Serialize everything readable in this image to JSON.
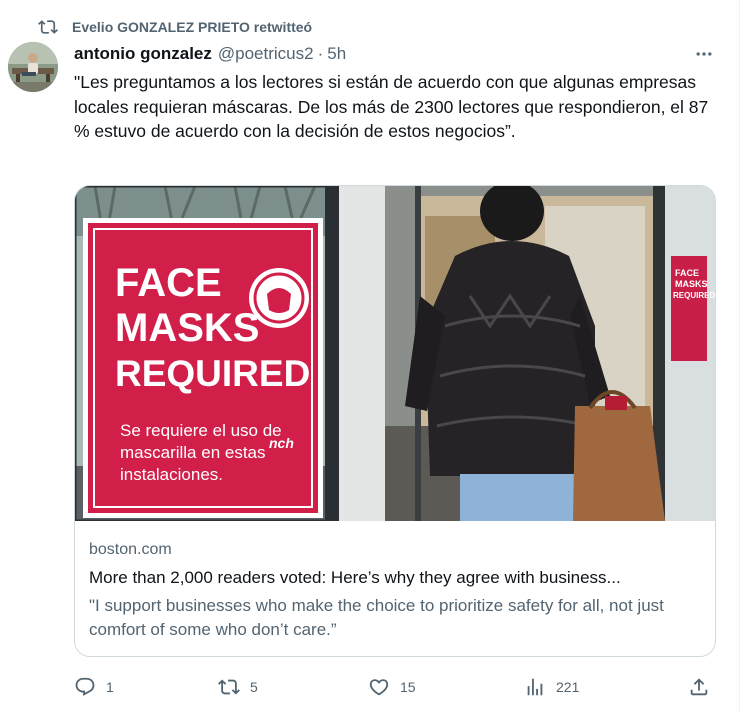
{
  "retweet_banner": {
    "icon": "retweet-icon",
    "text": "Evelio GONZALEZ PRIETO retwitteó"
  },
  "tweet": {
    "author_name": "antonio gonzalez",
    "author_handle": "@poetricus2",
    "separator": "·",
    "time": "5h",
    "text": "\"Les preguntamos a los lectores si están de acuerdo con que algunas empresas locales requieran máscaras. De los más de 2300 lectores que respondieron, el 87 % estuvo de acuerdo con la decisión de estos negocios”."
  },
  "card": {
    "image": {
      "sign_lines": [
        "FACE",
        "MASKS",
        "REQUIRED"
      ],
      "sign_subtext": [
        "Se requiere el uso de",
        "mascarilla en estas",
        "instalaciones."
      ],
      "sign_logo": "nch",
      "small_sign_lines": [
        "FACE",
        "MASKS",
        "REQUIRED"
      ],
      "colors": {
        "sign": "#d21f4a",
        "sign_border": "#ffffff",
        "jacket": "#1f1d1f",
        "jeans": "#8fb2d8",
        "bag": "#a0683f"
      }
    },
    "domain": "boston.com",
    "title": "More than 2,000 readers voted: Here’s why they agree with business...",
    "description": "\"I support businesses who make the choice to prioritize safety for all, not just comfort of some who don’t care.”"
  },
  "actions": {
    "reply": {
      "icon": "reply-icon",
      "count": "1"
    },
    "retweet": {
      "icon": "retweet-icon",
      "count": "5"
    },
    "like": {
      "icon": "heart-icon",
      "count": "15"
    },
    "views": {
      "icon": "views-icon",
      "count": "221"
    },
    "share": {
      "icon": "share-icon"
    }
  },
  "colors": {
    "text": "#0f1419",
    "secondary": "#536471",
    "border": "#cfd9de"
  }
}
